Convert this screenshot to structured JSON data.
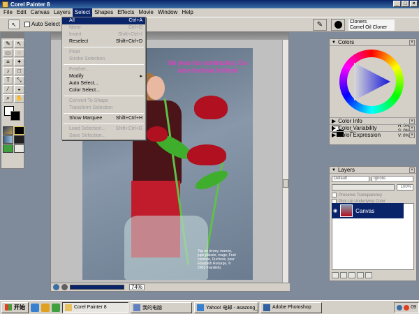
{
  "app": {
    "title": "Corel Painter 8"
  },
  "menubar": [
    "File",
    "Edit",
    "Canvas",
    "Layers",
    "Select",
    "Shapes",
    "Effects",
    "Movie",
    "Window",
    "Help"
  ],
  "propbar": {
    "auto_select_label": "Auto Select Layer",
    "brush_category": "Cloners",
    "brush_variant": "Camel Oil Cloner"
  },
  "select_menu": [
    {
      "label": "All",
      "shortcut": "Ctrl+A",
      "enabled": true,
      "highlight": true
    },
    {
      "label": "None",
      "shortcut": "Ctrl+D",
      "enabled": false
    },
    {
      "label": "Invert",
      "shortcut": "Shift+Ctrl+I",
      "enabled": false
    },
    {
      "label": "Reselect",
      "shortcut": "Shift+Ctrl+D",
      "enabled": true
    },
    {
      "sep": true
    },
    {
      "label": "Float",
      "shortcut": "",
      "enabled": false
    },
    {
      "label": "Stroke Selection",
      "shortcut": "",
      "enabled": false
    },
    {
      "sep": true
    },
    {
      "label": "Feather...",
      "shortcut": "",
      "enabled": false
    },
    {
      "label": "Modify",
      "shortcut": "▸",
      "enabled": true
    },
    {
      "label": "Auto Select...",
      "shortcut": "",
      "enabled": true
    },
    {
      "label": "Color Select...",
      "shortcut": "",
      "enabled": true
    },
    {
      "sep": true
    },
    {
      "label": "Convert To Shape",
      "shortcut": "",
      "enabled": false
    },
    {
      "label": "Transform Selection",
      "shortcut": "",
      "enabled": false
    },
    {
      "sep": true
    },
    {
      "label": "Show Marquee",
      "shortcut": "Shift+Ctrl+H",
      "enabled": true
    },
    {
      "sep": true
    },
    {
      "label": "Load Selection...",
      "shortcut": "Shift+Ctrl+G",
      "enabled": false
    },
    {
      "label": "Save Selection...",
      "shortcut": "",
      "enabled": false
    }
  ],
  "document": {
    "headline": "On joue les contrastes. Du rose fuchsia brillant",
    "caption": "Top en jersey, marron, jupe plissée, rouge, Fruit ceinture, Duchess, pour Elisabeth Rodarge, © 2003 Franklinb.",
    "zoom": "74%"
  },
  "colors_panel": {
    "title": "Colors",
    "hsv": [
      "H: 0%",
      "S: 0%",
      "V: 0%"
    ],
    "sub_panels": [
      "Color Info",
      "Color Variability",
      "Color Expression"
    ]
  },
  "layers_panel": {
    "title": "Layers",
    "composite_method": "Default",
    "composite_depth": "Ignore",
    "opacity": "100%",
    "preserve_transparency": "Preserve Transparency",
    "pick_up_color": "Pick Up Underlying Color",
    "layer_name": "Canvas"
  },
  "taskbar": {
    "start": "开始",
    "tasks": [
      {
        "label": "Corel Painter 8",
        "active": true
      },
      {
        "label": "我的电脑",
        "active": false
      },
      {
        "label": "Yahoo! 电邮 - asazong_l...",
        "active": false
      },
      {
        "label": "Adobe Photoshop",
        "active": false
      }
    ],
    "tray_time": "09"
  },
  "colors": {
    "highlight": "#0a246a",
    "title_start": "#0a246a",
    "panel_bg": "#d4d0c8",
    "headline_pink": "#e040c0"
  }
}
